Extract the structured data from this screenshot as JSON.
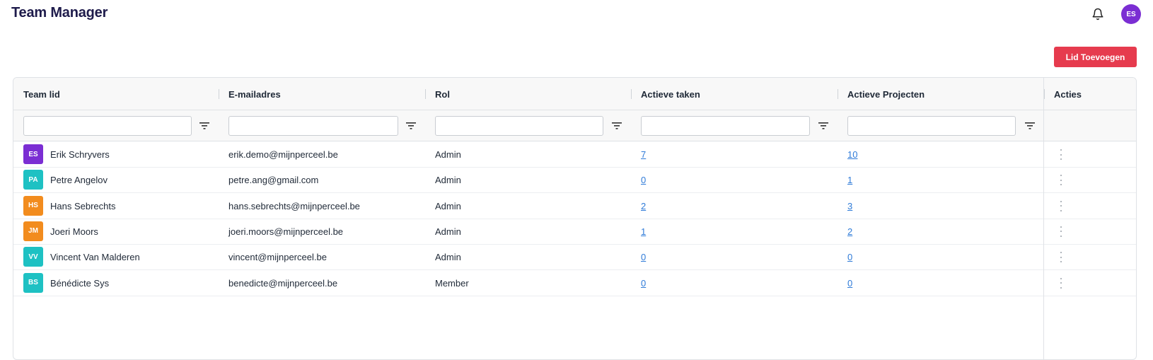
{
  "app": {
    "title": "Team Manager",
    "user_initials": "ES",
    "user_color": "#7b2ed3"
  },
  "toolbar": {
    "add_label": "Lid Toevoegen",
    "add_color": "#e63b4e"
  },
  "table": {
    "columns": [
      "Team lid",
      "E-mailadres",
      "Rol",
      "Actieve taken",
      "Actieve Projecten",
      "Acties"
    ],
    "filters": [
      "",
      "",
      "",
      "",
      ""
    ],
    "rows": [
      {
        "initials": "ES",
        "color": "#7b2ed3",
        "name": "Erik Schryvers",
        "email": "erik.demo@mijnperceel.be",
        "role": "Admin",
        "tasks": "7",
        "projects": "10"
      },
      {
        "initials": "PA",
        "color": "#1ec1c3",
        "name": "Petre Angelov",
        "email": "petre.ang@gmail.com",
        "role": "Admin",
        "tasks": "0",
        "projects": "1"
      },
      {
        "initials": "HS",
        "color": "#f28c1e",
        "name": "Hans Sebrechts",
        "email": "hans.sebrechts@mijnperceel.be",
        "role": "Admin",
        "tasks": "2",
        "projects": "3"
      },
      {
        "initials": "JM",
        "color": "#f28c1e",
        "name": "Joeri Moors",
        "email": "joeri.moors@mijnperceel.be",
        "role": "Admin",
        "tasks": "1",
        "projects": "2"
      },
      {
        "initials": "VV",
        "color": "#1ec1c3",
        "name": "Vincent Van Malderen",
        "email": "vincent@mijnperceel.be",
        "role": "Admin",
        "tasks": "0",
        "projects": "0"
      },
      {
        "initials": "BS",
        "color": "#1ec1c3",
        "name": "Bénédicte Sys",
        "email": "benedicte@mijnperceel.be",
        "role": "Member",
        "tasks": "0",
        "projects": "0"
      }
    ]
  },
  "icons": {
    "bell": "bell-icon",
    "filter": "filter-icon",
    "row_menu": "kebab-menu-icon"
  }
}
